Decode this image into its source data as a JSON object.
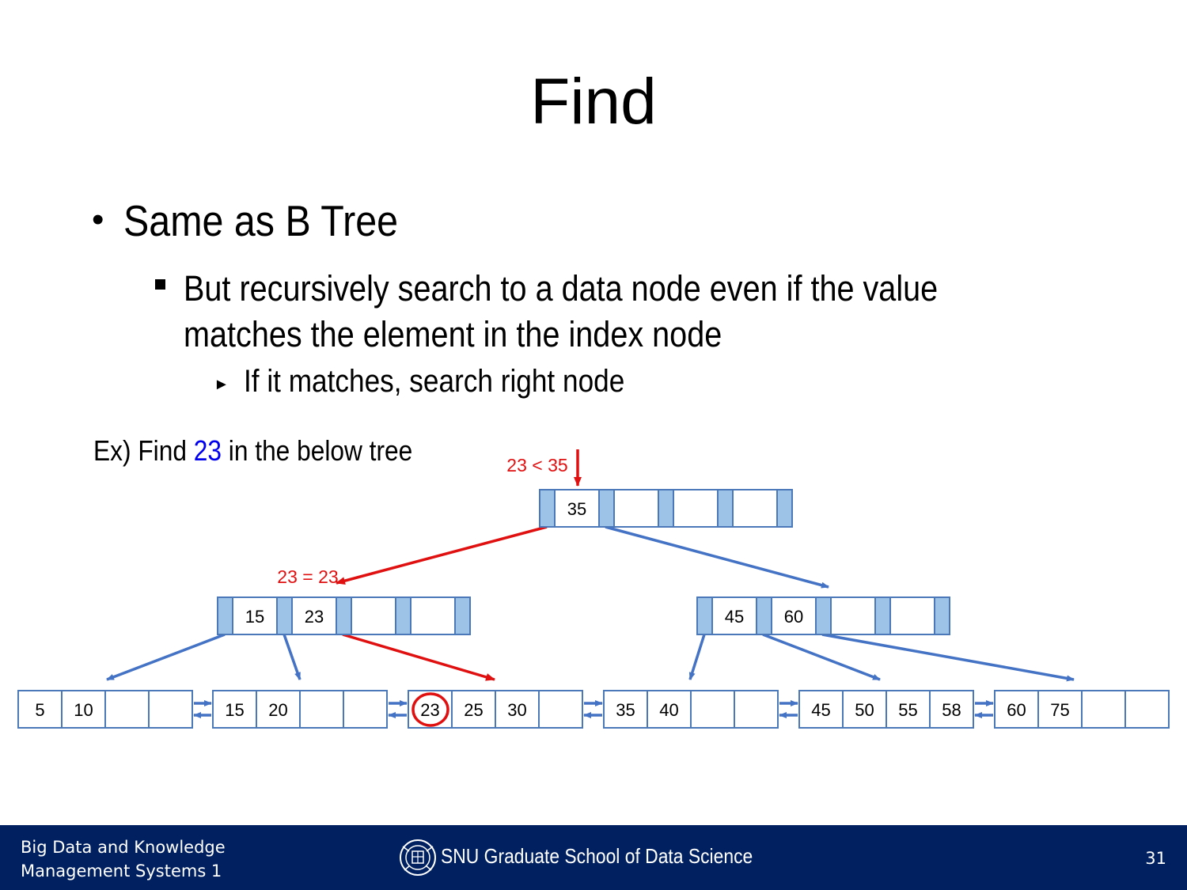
{
  "slide": {
    "title": "Find",
    "bullet1": "Same as B Tree",
    "bullet2_line1": "But recursively search to a data node even if the value",
    "bullet2_line2": "matches the element in the index node",
    "bullet3": "If it matches, search right node",
    "example_prefix": "Ex) Find ",
    "example_value": "23",
    "example_suffix": " in the below tree"
  },
  "tree": {
    "root": [
      "35",
      "",
      "",
      ""
    ],
    "index_left": [
      "15",
      "23",
      "",
      ""
    ],
    "index_right": [
      "45",
      "60",
      "",
      ""
    ],
    "leaves": [
      [
        "5",
        "10",
        "",
        ""
      ],
      [
        "15",
        "20",
        "",
        ""
      ],
      [
        "23",
        "25",
        "30",
        ""
      ],
      [
        "35",
        "40",
        "",
        ""
      ],
      [
        "45",
        "50",
        "55",
        "58"
      ],
      [
        "60",
        "75",
        "",
        ""
      ]
    ],
    "annotations": {
      "root_compare": "23 < 35",
      "index_compare": "23 = 23"
    },
    "found_value": "23",
    "colors": {
      "node_border": "#4a78b8",
      "pointer_fill": "#9dc3e6",
      "arrow_blue": "#4472c4",
      "arrow_red": "#e01010",
      "annotation_red": "#e01010"
    }
  },
  "footer": {
    "course_line1": "Big Data and Knowledge",
    "course_line2": "Management Systems 1",
    "school": "SNU Graduate School of Data Science",
    "page_number": "31",
    "logo_icon": "snu-emblem-icon"
  }
}
